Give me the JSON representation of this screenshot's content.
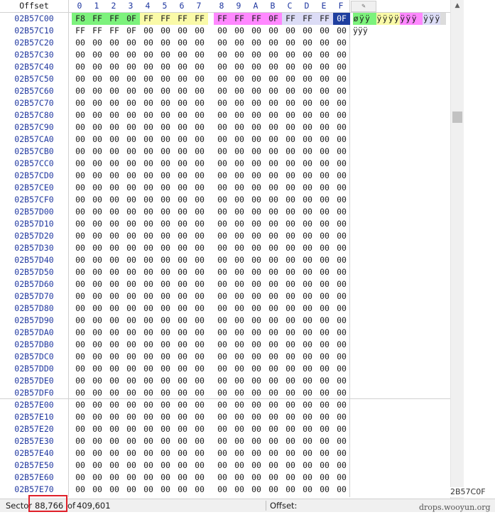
{
  "header": {
    "offset_label": "Offset",
    "columns": [
      "0",
      "1",
      "2",
      "3",
      "4",
      "5",
      "6",
      "7",
      "8",
      "9",
      "A",
      "B",
      "C",
      "D",
      "E",
      "F"
    ]
  },
  "rows": [
    {
      "offset": "02B57C00",
      "bytes": [
        "F8",
        "FF",
        "FF",
        "0F",
        "FF",
        "FF",
        "FF",
        "FF",
        "FF",
        "FF",
        "FF",
        "0F",
        "FF",
        "FF",
        "FF",
        "0F"
      ],
      "ascii": "øÿÿ ÿÿÿÿÿÿÿ ÿÿÿ "
    },
    {
      "offset": "02B57C10",
      "bytes": [
        "FF",
        "FF",
        "FF",
        "0F",
        "00",
        "00",
        "00",
        "00",
        "00",
        "00",
        "00",
        "00",
        "00",
        "00",
        "00",
        "00"
      ],
      "ascii": "ÿÿÿ"
    },
    {
      "offset": "02B57C20",
      "bytes": [
        "00",
        "00",
        "00",
        "00",
        "00",
        "00",
        "00",
        "00",
        "00",
        "00",
        "00",
        "00",
        "00",
        "00",
        "00",
        "00"
      ],
      "ascii": ""
    },
    {
      "offset": "02B57C30",
      "bytes": [
        "00",
        "00",
        "00",
        "00",
        "00",
        "00",
        "00",
        "00",
        "00",
        "00",
        "00",
        "00",
        "00",
        "00",
        "00",
        "00"
      ],
      "ascii": ""
    },
    {
      "offset": "02B57C40",
      "bytes": [
        "00",
        "00",
        "00",
        "00",
        "00",
        "00",
        "00",
        "00",
        "00",
        "00",
        "00",
        "00",
        "00",
        "00",
        "00",
        "00"
      ],
      "ascii": ""
    },
    {
      "offset": "02B57C50",
      "bytes": [
        "00",
        "00",
        "00",
        "00",
        "00",
        "00",
        "00",
        "00",
        "00",
        "00",
        "00",
        "00",
        "00",
        "00",
        "00",
        "00"
      ],
      "ascii": ""
    },
    {
      "offset": "02B57C60",
      "bytes": [
        "00",
        "00",
        "00",
        "00",
        "00",
        "00",
        "00",
        "00",
        "00",
        "00",
        "00",
        "00",
        "00",
        "00",
        "00",
        "00"
      ],
      "ascii": ""
    },
    {
      "offset": "02B57C70",
      "bytes": [
        "00",
        "00",
        "00",
        "00",
        "00",
        "00",
        "00",
        "00",
        "00",
        "00",
        "00",
        "00",
        "00",
        "00",
        "00",
        "00"
      ],
      "ascii": ""
    },
    {
      "offset": "02B57C80",
      "bytes": [
        "00",
        "00",
        "00",
        "00",
        "00",
        "00",
        "00",
        "00",
        "00",
        "00",
        "00",
        "00",
        "00",
        "00",
        "00",
        "00"
      ],
      "ascii": ""
    },
    {
      "offset": "02B57C90",
      "bytes": [
        "00",
        "00",
        "00",
        "00",
        "00",
        "00",
        "00",
        "00",
        "00",
        "00",
        "00",
        "00",
        "00",
        "00",
        "00",
        "00"
      ],
      "ascii": ""
    },
    {
      "offset": "02B57CA0",
      "bytes": [
        "00",
        "00",
        "00",
        "00",
        "00",
        "00",
        "00",
        "00",
        "00",
        "00",
        "00",
        "00",
        "00",
        "00",
        "00",
        "00"
      ],
      "ascii": ""
    },
    {
      "offset": "02B57CB0",
      "bytes": [
        "00",
        "00",
        "00",
        "00",
        "00",
        "00",
        "00",
        "00",
        "00",
        "00",
        "00",
        "00",
        "00",
        "00",
        "00",
        "00"
      ],
      "ascii": ""
    },
    {
      "offset": "02B57CC0",
      "bytes": [
        "00",
        "00",
        "00",
        "00",
        "00",
        "00",
        "00",
        "00",
        "00",
        "00",
        "00",
        "00",
        "00",
        "00",
        "00",
        "00"
      ],
      "ascii": ""
    },
    {
      "offset": "02B57CD0",
      "bytes": [
        "00",
        "00",
        "00",
        "00",
        "00",
        "00",
        "00",
        "00",
        "00",
        "00",
        "00",
        "00",
        "00",
        "00",
        "00",
        "00"
      ],
      "ascii": ""
    },
    {
      "offset": "02B57CE0",
      "bytes": [
        "00",
        "00",
        "00",
        "00",
        "00",
        "00",
        "00",
        "00",
        "00",
        "00",
        "00",
        "00",
        "00",
        "00",
        "00",
        "00"
      ],
      "ascii": ""
    },
    {
      "offset": "02B57CF0",
      "bytes": [
        "00",
        "00",
        "00",
        "00",
        "00",
        "00",
        "00",
        "00",
        "00",
        "00",
        "00",
        "00",
        "00",
        "00",
        "00",
        "00"
      ],
      "ascii": ""
    },
    {
      "offset": "02B57D00",
      "bytes": [
        "00",
        "00",
        "00",
        "00",
        "00",
        "00",
        "00",
        "00",
        "00",
        "00",
        "00",
        "00",
        "00",
        "00",
        "00",
        "00"
      ],
      "ascii": ""
    },
    {
      "offset": "02B57D10",
      "bytes": [
        "00",
        "00",
        "00",
        "00",
        "00",
        "00",
        "00",
        "00",
        "00",
        "00",
        "00",
        "00",
        "00",
        "00",
        "00",
        "00"
      ],
      "ascii": ""
    },
    {
      "offset": "02B57D20",
      "bytes": [
        "00",
        "00",
        "00",
        "00",
        "00",
        "00",
        "00",
        "00",
        "00",
        "00",
        "00",
        "00",
        "00",
        "00",
        "00",
        "00"
      ],
      "ascii": ""
    },
    {
      "offset": "02B57D30",
      "bytes": [
        "00",
        "00",
        "00",
        "00",
        "00",
        "00",
        "00",
        "00",
        "00",
        "00",
        "00",
        "00",
        "00",
        "00",
        "00",
        "00"
      ],
      "ascii": ""
    },
    {
      "offset": "02B57D40",
      "bytes": [
        "00",
        "00",
        "00",
        "00",
        "00",
        "00",
        "00",
        "00",
        "00",
        "00",
        "00",
        "00",
        "00",
        "00",
        "00",
        "00"
      ],
      "ascii": ""
    },
    {
      "offset": "02B57D50",
      "bytes": [
        "00",
        "00",
        "00",
        "00",
        "00",
        "00",
        "00",
        "00",
        "00",
        "00",
        "00",
        "00",
        "00",
        "00",
        "00",
        "00"
      ],
      "ascii": ""
    },
    {
      "offset": "02B57D60",
      "bytes": [
        "00",
        "00",
        "00",
        "00",
        "00",
        "00",
        "00",
        "00",
        "00",
        "00",
        "00",
        "00",
        "00",
        "00",
        "00",
        "00"
      ],
      "ascii": ""
    },
    {
      "offset": "02B57D70",
      "bytes": [
        "00",
        "00",
        "00",
        "00",
        "00",
        "00",
        "00",
        "00",
        "00",
        "00",
        "00",
        "00",
        "00",
        "00",
        "00",
        "00"
      ],
      "ascii": ""
    },
    {
      "offset": "02B57D80",
      "bytes": [
        "00",
        "00",
        "00",
        "00",
        "00",
        "00",
        "00",
        "00",
        "00",
        "00",
        "00",
        "00",
        "00",
        "00",
        "00",
        "00"
      ],
      "ascii": ""
    },
    {
      "offset": "02B57D90",
      "bytes": [
        "00",
        "00",
        "00",
        "00",
        "00",
        "00",
        "00",
        "00",
        "00",
        "00",
        "00",
        "00",
        "00",
        "00",
        "00",
        "00"
      ],
      "ascii": ""
    },
    {
      "offset": "02B57DA0",
      "bytes": [
        "00",
        "00",
        "00",
        "00",
        "00",
        "00",
        "00",
        "00",
        "00",
        "00",
        "00",
        "00",
        "00",
        "00",
        "00",
        "00"
      ],
      "ascii": ""
    },
    {
      "offset": "02B57DB0",
      "bytes": [
        "00",
        "00",
        "00",
        "00",
        "00",
        "00",
        "00",
        "00",
        "00",
        "00",
        "00",
        "00",
        "00",
        "00",
        "00",
        "00"
      ],
      "ascii": ""
    },
    {
      "offset": "02B57DC0",
      "bytes": [
        "00",
        "00",
        "00",
        "00",
        "00",
        "00",
        "00",
        "00",
        "00",
        "00",
        "00",
        "00",
        "00",
        "00",
        "00",
        "00"
      ],
      "ascii": ""
    },
    {
      "offset": "02B57DD0",
      "bytes": [
        "00",
        "00",
        "00",
        "00",
        "00",
        "00",
        "00",
        "00",
        "00",
        "00",
        "00",
        "00",
        "00",
        "00",
        "00",
        "00"
      ],
      "ascii": ""
    },
    {
      "offset": "02B57DE0",
      "bytes": [
        "00",
        "00",
        "00",
        "00",
        "00",
        "00",
        "00",
        "00",
        "00",
        "00",
        "00",
        "00",
        "00",
        "00",
        "00",
        "00"
      ],
      "ascii": ""
    },
    {
      "offset": "02B57DF0",
      "bytes": [
        "00",
        "00",
        "00",
        "00",
        "00",
        "00",
        "00",
        "00",
        "00",
        "00",
        "00",
        "00",
        "00",
        "00",
        "00",
        "00"
      ],
      "ascii": ""
    },
    {
      "offset": "02B57E00",
      "bytes": [
        "00",
        "00",
        "00",
        "00",
        "00",
        "00",
        "00",
        "00",
        "00",
        "00",
        "00",
        "00",
        "00",
        "00",
        "00",
        "00"
      ],
      "ascii": ""
    },
    {
      "offset": "02B57E10",
      "bytes": [
        "00",
        "00",
        "00",
        "00",
        "00",
        "00",
        "00",
        "00",
        "00",
        "00",
        "00",
        "00",
        "00",
        "00",
        "00",
        "00"
      ],
      "ascii": ""
    },
    {
      "offset": "02B57E20",
      "bytes": [
        "00",
        "00",
        "00",
        "00",
        "00",
        "00",
        "00",
        "00",
        "00",
        "00",
        "00",
        "00",
        "00",
        "00",
        "00",
        "00"
      ],
      "ascii": ""
    },
    {
      "offset": "02B57E30",
      "bytes": [
        "00",
        "00",
        "00",
        "00",
        "00",
        "00",
        "00",
        "00",
        "00",
        "00",
        "00",
        "00",
        "00",
        "00",
        "00",
        "00"
      ],
      "ascii": ""
    },
    {
      "offset": "02B57E40",
      "bytes": [
        "00",
        "00",
        "00",
        "00",
        "00",
        "00",
        "00",
        "00",
        "00",
        "00",
        "00",
        "00",
        "00",
        "00",
        "00",
        "00"
      ],
      "ascii": ""
    },
    {
      "offset": "02B57E50",
      "bytes": [
        "00",
        "00",
        "00",
        "00",
        "00",
        "00",
        "00",
        "00",
        "00",
        "00",
        "00",
        "00",
        "00",
        "00",
        "00",
        "00"
      ],
      "ascii": ""
    },
    {
      "offset": "02B57E60",
      "bytes": [
        "00",
        "00",
        "00",
        "00",
        "00",
        "00",
        "00",
        "00",
        "00",
        "00",
        "00",
        "00",
        "00",
        "00",
        "00",
        "00"
      ],
      "ascii": ""
    },
    {
      "offset": "02B57E70",
      "bytes": [
        "00",
        "00",
        "00",
        "00",
        "00",
        "00",
        "00",
        "00",
        "00",
        "00",
        "00",
        "00",
        "00",
        "00",
        "00",
        "00"
      ],
      "ascii": ""
    }
  ],
  "highlights": {
    "row0_hex": [
      "green",
      "green",
      "green",
      "green",
      "yellow",
      "yellow",
      "yellow",
      "yellow",
      "pink",
      "pink",
      "pink",
      "pink",
      "lavender",
      "lavender",
      "lavender",
      "cursor"
    ],
    "row0_ascii": [
      "green",
      "green",
      "green",
      "green",
      "yellow",
      "yellow",
      "yellow",
      "yellow",
      "pink",
      "pink",
      "pink",
      "pink",
      "lavender",
      "lavender",
      "lavender",
      "gray"
    ]
  },
  "colors": {
    "green": "#7cf27c",
    "yellow": "#fafaa8",
    "pink": "#ff88ff",
    "lavender": "#dcdcf6",
    "cursor": "#1f3f9f",
    "offset_text": "#2038a0",
    "redbox": "#e0202a"
  },
  "status": {
    "sector_label": "Sector",
    "sector_value": "88,766",
    "of_label": "of",
    "sector_total": "409,601",
    "offset_label": "Offset:",
    "offset_value": "2B57C0F"
  },
  "icons": {
    "ascii_tab": "pencil-icon",
    "scroll_up": "arrow-up-icon",
    "scroll_down": "arrow-down-icon"
  },
  "watermark": "drops.wooyun.org"
}
